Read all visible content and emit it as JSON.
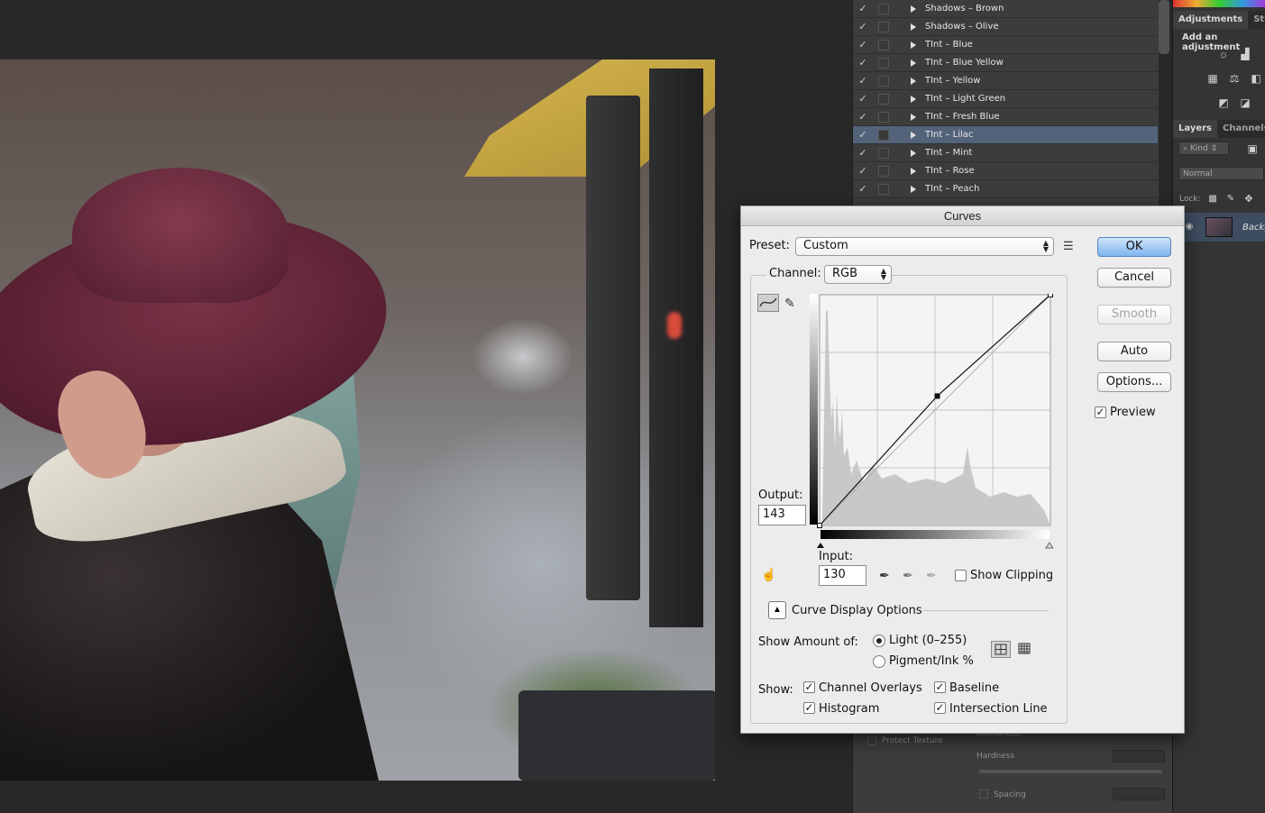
{
  "styles_panel": {
    "items": [
      {
        "label": "Shadows – Brown"
      },
      {
        "label": "Shadows – Olive"
      },
      {
        "label": "TInt – Blue"
      },
      {
        "label": "TInt – Blue Yellow"
      },
      {
        "label": "TInt – Yellow"
      },
      {
        "label": "TInt – Light Green"
      },
      {
        "label": "TInt – Fresh Blue"
      },
      {
        "label": "TInt – Lilac"
      },
      {
        "label": "TInt – Mint"
      },
      {
        "label": "TInt – Rose"
      },
      {
        "label": "TInt – Peach"
      }
    ],
    "selected": "TInt – Lilac",
    "check_mark": "✓"
  },
  "adjustments_panel": {
    "tab_adjustments": "Adjustments",
    "tab_styles": "Style",
    "title": "Add an adjustment"
  },
  "layers_panel": {
    "tab_layers": "Layers",
    "tab_channels": "Channels",
    "kind_filter": "Kind",
    "blend_mode": "Normal",
    "lock_label": "Lock:",
    "layer_name": "Backg"
  },
  "brush_panel": {
    "protect_texture": "Protect Texture",
    "roundness": "Roundness:",
    "hardness": "Hardness",
    "spacing": "Spacing"
  },
  "curves_dialog": {
    "title": "Curves",
    "preset_label": "Preset:",
    "preset_value": "Custom",
    "channel_label": "Channel:",
    "channel_value": "RGB",
    "output_label": "Output:",
    "output_value": "143",
    "input_label": "Input:",
    "input_value": "130",
    "show_clipping_label": "Show Clipping",
    "show_clipping_checked": false,
    "buttons": {
      "ok": "OK",
      "cancel": "Cancel",
      "smooth": "Smooth",
      "auto": "Auto",
      "options": "Options..."
    },
    "preview_label": "Preview",
    "preview_checked": true,
    "curve_display_options_label": "Curve Display Options",
    "show_amount_label": "Show Amount of:",
    "light_option": "Light  (0–255)",
    "pigment_option": "Pigment/Ink %",
    "selected_amount": "light",
    "show_label": "Show:",
    "show_options": {
      "channel_overlays": "Channel Overlays",
      "baseline": "Baseline",
      "histogram": "Histogram",
      "intersection_line": "Intersection Line"
    },
    "curve_points": [
      [
        0,
        0
      ],
      [
        130,
        143
      ],
      [
        255,
        255
      ]
    ]
  }
}
